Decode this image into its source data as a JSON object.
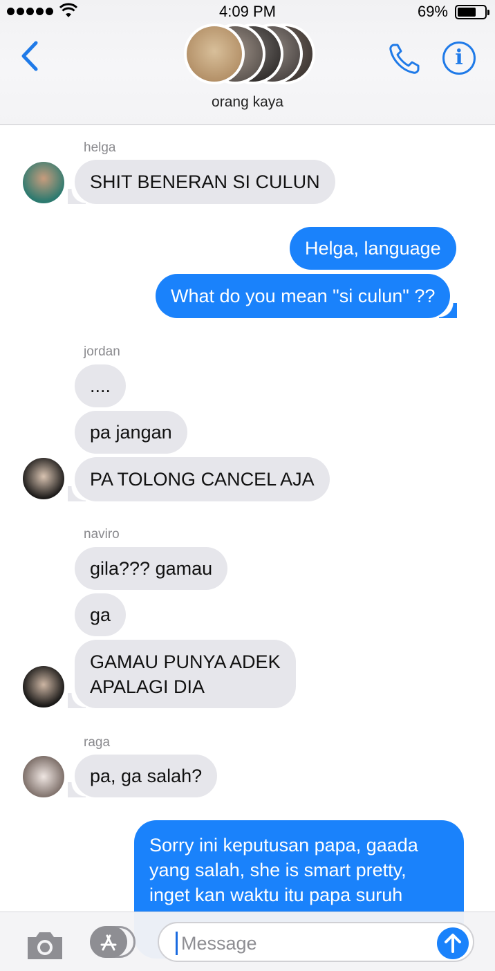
{
  "status": {
    "time": "4:09 PM",
    "battery": "69%"
  },
  "header": {
    "group_name": "orang kaya"
  },
  "conversation": {
    "groups": [
      {
        "sender": "helga",
        "messages": [
          "SHIT BENERAN SI CULUN"
        ]
      },
      {
        "sender": "me",
        "messages": [
          "Helga, language",
          "What do you mean \"si culun\" ??"
        ]
      },
      {
        "sender": "jordan",
        "messages": [
          "....",
          "pa jangan",
          "PA TOLONG CANCEL AJA"
        ]
      },
      {
        "sender": "naviro",
        "messages": [
          "gila??? gamau",
          "ga",
          "GAMAU PUNYA ADEK",
          "APALAGI DIA"
        ]
      },
      {
        "sender": "raga",
        "messages": [
          "pa, ga salah?"
        ]
      },
      {
        "sender": "me",
        "messages": [
          "Sorry ini keputusan papa, gaada",
          "yang salah, she is smart pretty,",
          "inget kan waktu itu papa suruh"
        ]
      }
    ]
  },
  "input": {
    "placeholder": "Message"
  },
  "icons": {
    "back": "chevron-left-icon",
    "call": "phone-icon",
    "info": "info-icon",
    "camera": "camera-icon",
    "apps": "app-store-icon",
    "send": "arrow-up-icon"
  },
  "colors": {
    "accent": "#1a82fb",
    "incoming_bubble": "#e6e6eb",
    "sender_name": "#8a8a8e"
  }
}
